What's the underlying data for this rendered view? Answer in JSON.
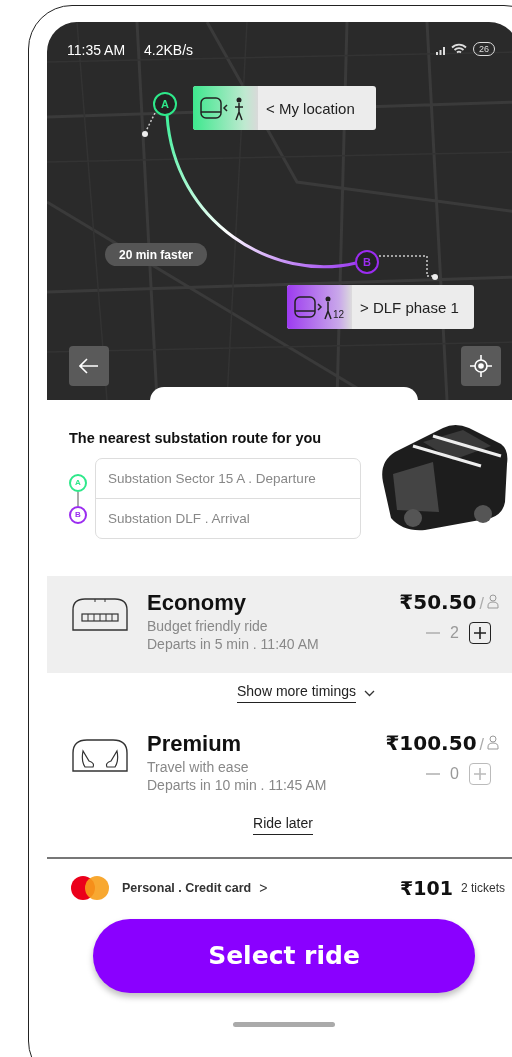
{
  "status_bar": {
    "time": "11:35 AM",
    "speed": "4.2KB/s",
    "battery": "26"
  },
  "map": {
    "origin_marker": "A",
    "origin_label": "< My location",
    "destination_marker": "B",
    "destination_label": "> DLF phase 1",
    "walk_minutes": "12",
    "badge": "20 min faster"
  },
  "sheet": {
    "title": "The nearest substation route for you",
    "stops": [
      {
        "marker": "A",
        "label": "Substation Sector 15 A . Departure",
        "color": "#2ee88a"
      },
      {
        "marker": "B",
        "label": "Substation DLF . Arrival",
        "color": "#9b2cf0"
      }
    ]
  },
  "rides": [
    {
      "kind": "economy",
      "name": "Economy",
      "subtitle": "Budget friendly ride",
      "departs": "Departs in 5 min . 11:40 AM",
      "price": "₹50.50",
      "per": "/",
      "quantity": "2",
      "selected": true
    },
    {
      "kind": "premium",
      "name": "Premium",
      "subtitle": "Travel with ease",
      "departs": "Departs in 10 min . 11:45 AM",
      "price": "₹100.50",
      "per": "/",
      "quantity": "0",
      "selected": false
    }
  ],
  "show_more": "Show more timings",
  "ride_later": "Ride later",
  "payment": {
    "label": "Personal . Credit card",
    "chevron": ">",
    "total": "₹101",
    "tickets": "2 tickets"
  },
  "select_button": "Select ride"
}
